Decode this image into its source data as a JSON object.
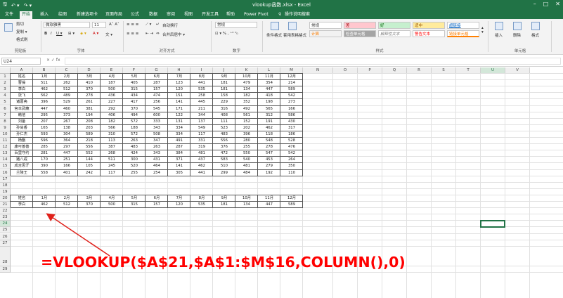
{
  "titlebar": {
    "title": "vlookup函数.xlsx - Excel",
    "qa_icons": [
      "save-icon",
      "undo-icon",
      "redo-icon"
    ]
  },
  "tabs": [
    "文件",
    "开始",
    "插入",
    "绘图",
    "新建选项卡",
    "页面布局",
    "公式",
    "数据",
    "审阅",
    "视图",
    "开发工具",
    "帮助",
    "Power Pivot",
    "操作说明搜索"
  ],
  "ribbon": {
    "clipboard": {
      "cut": "剪切",
      "copy": "复制 ▾",
      "painter": "格式刷",
      "label": "剪贴板"
    },
    "font": {
      "name": "微软雅黑",
      "size": "11",
      "label": "字体"
    },
    "alignment": {
      "wrap": "自动换行",
      "merge": "合并后居中 ▾",
      "label": "对齐方式"
    },
    "number": {
      "format": "常规",
      "label": "数字"
    },
    "styles": {
      "conditional": "条件格式",
      "table": "套用表格格式",
      "cells": [
        "常规",
        "差",
        "好",
        "适中",
        "超链接",
        "计算",
        "检查单元格",
        "解释性文本",
        "警告文本",
        "链接单元格"
      ],
      "label": "样式"
    },
    "cells_group": {
      "insert": "插入",
      "delete": "删除",
      "format": "格式",
      "label": "单元格"
    }
  },
  "formula_bar": {
    "name_box": "U24",
    "fx": "× ✓ fx",
    "content": ""
  },
  "columns": [
    "A",
    "B",
    "C",
    "D",
    "E",
    "F",
    "G",
    "H",
    "I",
    "J",
    "K",
    "L",
    "M",
    "N",
    "O",
    "P",
    "Q",
    "R",
    "S",
    "T",
    "U",
    "V"
  ],
  "rows": [
    1,
    2,
    3,
    4,
    5,
    6,
    7,
    8,
    9,
    10,
    11,
    12,
    13,
    14,
    15,
    16,
    17,
    18,
    19,
    20,
    21,
    22,
    23,
    24,
    25,
    26,
    27,
    28,
    29
  ],
  "table_top": {
    "header": [
      "姓名",
      "1月",
      "2月",
      "3月",
      "4月",
      "5月",
      "6月",
      "7月",
      "8月",
      "9月",
      "10月",
      "11月",
      "12月"
    ],
    "rows": [
      [
        "曹操",
        "511",
        "262",
        "410",
        "187",
        "405",
        "287",
        "123",
        "441",
        "181",
        "479",
        "354",
        "214"
      ],
      [
        "李白",
        "462",
        "512",
        "370",
        "500",
        "315",
        "157",
        "120",
        "535",
        "181",
        "134",
        "447",
        "589"
      ],
      [
        "张飞",
        "562",
        "489",
        "278",
        "436",
        "434",
        "474",
        "151",
        "258",
        "158",
        "182",
        "418",
        "542"
      ],
      [
        "诸葛亮",
        "396",
        "529",
        "261",
        "227",
        "417",
        "256",
        "141",
        "445",
        "229",
        "352",
        "198",
        "273"
      ],
      [
        "宫本武藏",
        "447",
        "460",
        "381",
        "292",
        "370",
        "545",
        "171",
        "211",
        "316",
        "492",
        "565",
        "166"
      ],
      [
        "韩信",
        "295",
        "373",
        "194",
        "406",
        "494",
        "600",
        "122",
        "344",
        "408",
        "561",
        "312",
        "586"
      ],
      [
        "刘备",
        "207",
        "267",
        "208",
        "182",
        "572",
        "333",
        "131",
        "137",
        "111",
        "152",
        "191",
        "430"
      ],
      [
        "孙尚香",
        "165",
        "138",
        "203",
        "566",
        "188",
        "343",
        "334",
        "549",
        "523",
        "202",
        "462",
        "317"
      ],
      [
        "孙仁杰",
        "593",
        "304",
        "589",
        "310",
        "572",
        "508",
        "334",
        "117",
        "483",
        "396",
        "118",
        "186"
      ],
      [
        "杨戬",
        "596",
        "364",
        "218",
        "113",
        "263",
        "347",
        "491",
        "331",
        "556",
        "280",
        "548",
        "528"
      ],
      [
        "康可善善",
        "285",
        "297",
        "556",
        "387",
        "483",
        "263",
        "287",
        "319",
        "376",
        "255",
        "278",
        "476"
      ],
      [
        "百里守约",
        "281",
        "447",
        "552",
        "268",
        "424",
        "343",
        "384",
        "481",
        "472",
        "550",
        "547",
        "542"
      ],
      [
        "猪八戒",
        "170",
        "251",
        "144",
        "511",
        "300",
        "431",
        "371",
        "437",
        "583",
        "540",
        "453",
        "264"
      ],
      [
        "成吉思汗",
        "390",
        "166",
        "105",
        "245",
        "520",
        "464",
        "141",
        "462",
        "510",
        "481",
        "279",
        "350"
      ],
      [
        "兰陵王",
        "558",
        "401",
        "242",
        "117",
        "255",
        "254",
        "305",
        "441",
        "299",
        "484",
        "192",
        "110"
      ]
    ]
  },
  "table_bottom": {
    "header": [
      "姓名",
      "1月",
      "2月",
      "3月",
      "4月",
      "5月",
      "6月",
      "7月",
      "8月",
      "9月",
      "10月",
      "11月",
      "12月"
    ],
    "row": [
      "李白",
      "462",
      "512",
      "370",
      "500",
      "315",
      "157",
      "120",
      "535",
      "181",
      "134",
      "447",
      "589"
    ]
  },
  "annotation": {
    "formula": "=VLOOKUP($A$21,$A$1:$M$16,COLUMN(),0)",
    "color": "#ff0000"
  },
  "colors": {
    "excel_green": "#217346",
    "ribbon_bg": "#f3f3f3",
    "grid_line": "#e1e1e1"
  }
}
